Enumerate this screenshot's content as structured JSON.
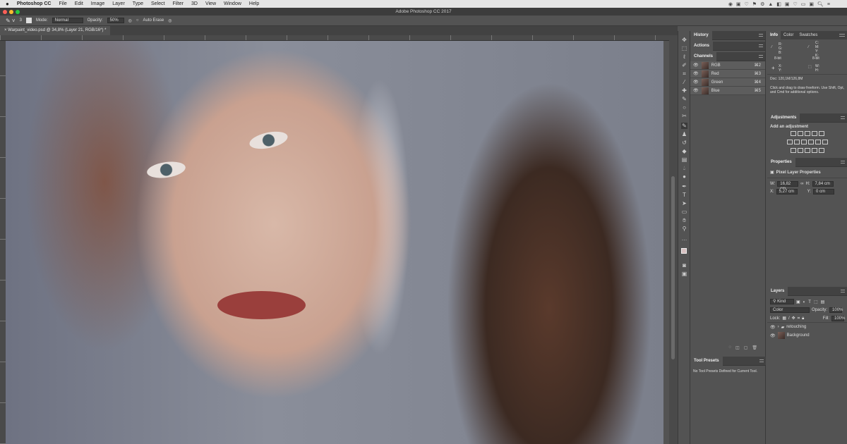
{
  "menubar": {
    "apple": "",
    "app": "Photoshop CC",
    "items": [
      "File",
      "Edit",
      "Image",
      "Layer",
      "Type",
      "Select",
      "Filter",
      "3D",
      "View",
      "Window",
      "Help"
    ]
  },
  "window": {
    "title": "Adobe Photoshop CC 2017"
  },
  "options": {
    "mode_label": "Mode:",
    "mode_value": "Normal",
    "opacity_label": "Opacity:",
    "opacity_value": "50%",
    "auto_erase": "Auto Erase",
    "brush_size": "3"
  },
  "document": {
    "tab": "Warpaint_video.psd @ 34,8% (Layer 21, RGB/16*) *"
  },
  "panels": {
    "history": "History",
    "actions": "Actions",
    "channels": "Channels",
    "channel_rows": [
      {
        "name": "RGB",
        "shortcut": "⌘2"
      },
      {
        "name": "Red",
        "shortcut": "⌘3"
      },
      {
        "name": "Green",
        "shortcut": "⌘4"
      },
      {
        "name": "Blue",
        "shortcut": "⌘5"
      }
    ],
    "info_tabs": [
      "Info",
      "Color",
      "Swatches"
    ],
    "info": {
      "rgb": "R:\nG:\nB:",
      "cmyk": "C:\nM:\nY:\nK:",
      "bit1": "8-bit",
      "bit2": "8-bit",
      "xy": "X:\nY:",
      "wh": "W:\nH:",
      "doc": "Doc: 120,1M/126,8M",
      "hint": "Click and drag to draw freeform.  Use Shift, Opt, and Cmd for additional options."
    },
    "adjustments": {
      "title": "Adjustments",
      "subtitle": "Add an adjustment"
    },
    "properties": {
      "title": "Properties",
      "type": "Pixel Layer Properties",
      "w_label": "W:",
      "w": "16,82 cm",
      "h_label": "H:",
      "h": "7,84 cm",
      "x_label": "X:",
      "x": "5,27 cm",
      "y_label": "Y:",
      "y": "0 cm"
    },
    "tool_presets": {
      "title": "Tool Presets",
      "empty": "No Tool Presets Defined for Current Tool."
    },
    "layers": {
      "title": "Layers",
      "filter": "Kind",
      "blend": "Color",
      "opacity_label": "Opacity:",
      "opacity": "100%",
      "lock_label": "Lock:",
      "fill_label": "Fill:",
      "fill": "100%",
      "items": [
        {
          "name": "retouching",
          "type": "group"
        },
        {
          "name": "Background",
          "type": "pixel"
        }
      ]
    }
  }
}
